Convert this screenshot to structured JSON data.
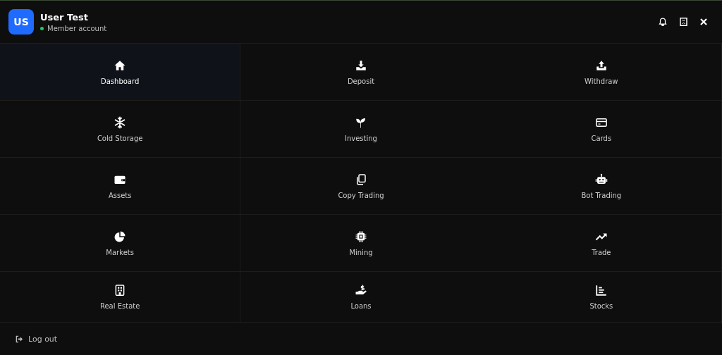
{
  "user": {
    "initials": "US",
    "name": "User Test",
    "status": "Member account",
    "online": true
  },
  "menu": [
    {
      "label": "Dashboard",
      "selected": true
    },
    {
      "label": "Deposit",
      "selected": false
    },
    {
      "label": "Withdraw",
      "selected": false
    },
    {
      "label": "Cold Storage",
      "selected": false
    },
    {
      "label": "Investing",
      "selected": false
    },
    {
      "label": "Cards",
      "selected": false
    },
    {
      "label": "Assets",
      "selected": false
    },
    {
      "label": "Copy Trading",
      "selected": false
    },
    {
      "label": "Bot Trading",
      "selected": false
    },
    {
      "label": "Markets",
      "selected": false
    },
    {
      "label": "Mining",
      "selected": false
    },
    {
      "label": "Trade",
      "selected": false
    },
    {
      "label": "Real Estate",
      "selected": false
    },
    {
      "label": "Loans",
      "selected": false
    },
    {
      "label": "Stocks",
      "selected": false
    }
  ],
  "footer": {
    "logout": "Log out"
  }
}
